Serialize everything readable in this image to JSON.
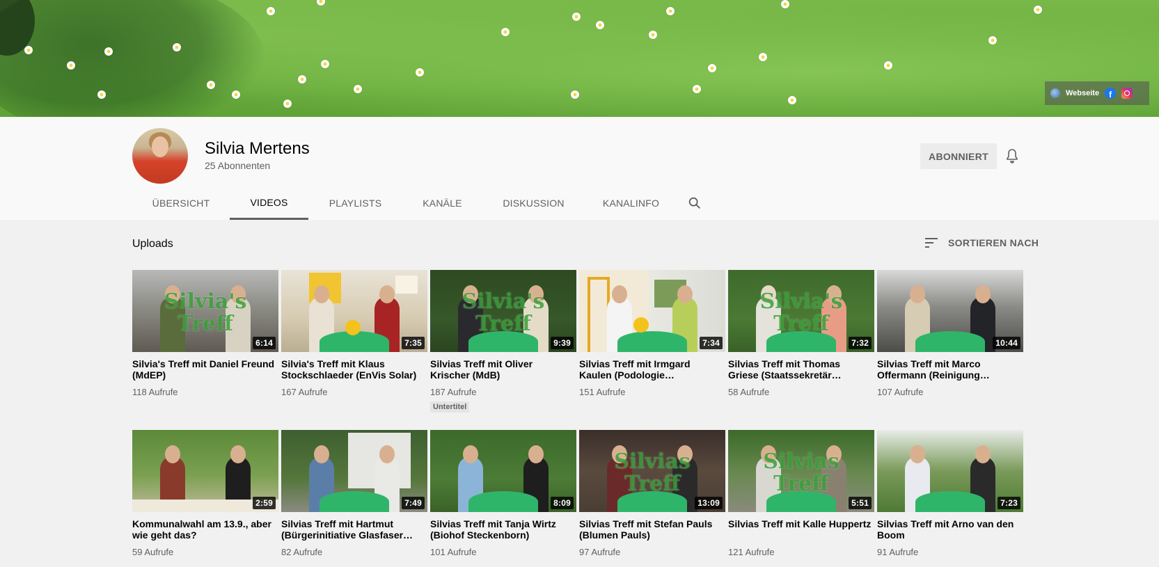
{
  "banner": {
    "links": {
      "website_label": "Webseite",
      "icons": [
        "globe-icon",
        "facebook-icon",
        "instagram-icon"
      ]
    }
  },
  "channel": {
    "name": "Silvia Mertens",
    "subscribers": "25 Abonnenten",
    "subscribe_button": "ABONNIERT"
  },
  "tabs": [
    {
      "label": "ÜBERSICHT",
      "active": false
    },
    {
      "label": "VIDEOS",
      "active": true
    },
    {
      "label": "PLAYLISTS",
      "active": false
    },
    {
      "label": "KANÄLE",
      "active": false
    },
    {
      "label": "DISKUSSION",
      "active": false
    },
    {
      "label": "KANALINFO",
      "active": false
    }
  ],
  "section": {
    "title": "Uploads",
    "sort_label": "SORTIEREN NACH"
  },
  "videos": [
    {
      "title": "Silvia's Treff mit Daniel Freund (MdEP)",
      "views": "118 Aufrufe",
      "duration": "6:14",
      "logo_line1": "Silvia's",
      "logo_line2": "Treff"
    },
    {
      "title": "Silvia's Treff mit Klaus Stockschlaeder (EnVis Solar)",
      "views": "167 Aufrufe",
      "duration": "7:35"
    },
    {
      "title": "Silvias Treff mit Oliver Krischer (MdB)",
      "views": "187 Aufrufe",
      "duration": "9:39",
      "badge": "Untertitel",
      "logo_line1": "Silvia's",
      "logo_line2": "Treff"
    },
    {
      "title": "Silvias Treff mit Irmgard Kaulen (Podologie…",
      "views": "151 Aufrufe",
      "duration": "7:34"
    },
    {
      "title": "Silvias Treff mit Thomas Griese (Staatssekretär…",
      "views": "58 Aufrufe",
      "duration": "7:32",
      "logo_line1": "Silvia's",
      "logo_line2": "Treff"
    },
    {
      "title": "Silvias Treff mit Marco Offermann (Reinigung…",
      "views": "107 Aufrufe",
      "duration": "10:44"
    },
    {
      "title": "Kommunalwahl am 13.9., aber wie geht das?",
      "views": "59 Aufrufe",
      "duration": "2:59"
    },
    {
      "title": "Silvias Treff mit Hartmut (Bürgerinitiative Glasfaser…",
      "views": "82 Aufrufe",
      "duration": "7:49"
    },
    {
      "title": "Silvias Treff mit Tanja Wirtz (Biohof Steckenborn)",
      "views": "101 Aufrufe",
      "duration": "8:09"
    },
    {
      "title": "Silvias Treff mit Stefan Pauls (Blumen Pauls)",
      "views": "97 Aufrufe",
      "duration": "13:09",
      "logo_line1": "Silvias",
      "logo_line2": "Treff"
    },
    {
      "title": "Silvias Treff mit Kalle Huppertz",
      "views": "121 Aufrufe",
      "duration": "5:51",
      "logo_line1": "Silvias",
      "logo_line2": "Treff"
    },
    {
      "title": "Silvias Treff mit Arno van den Boom",
      "views": "91 Aufrufe",
      "duration": "7:23"
    }
  ],
  "colors": {
    "active_tab_underline": "#606060",
    "text_primary": "#030303",
    "text_secondary": "#606060",
    "background": "#f1f1f1"
  }
}
